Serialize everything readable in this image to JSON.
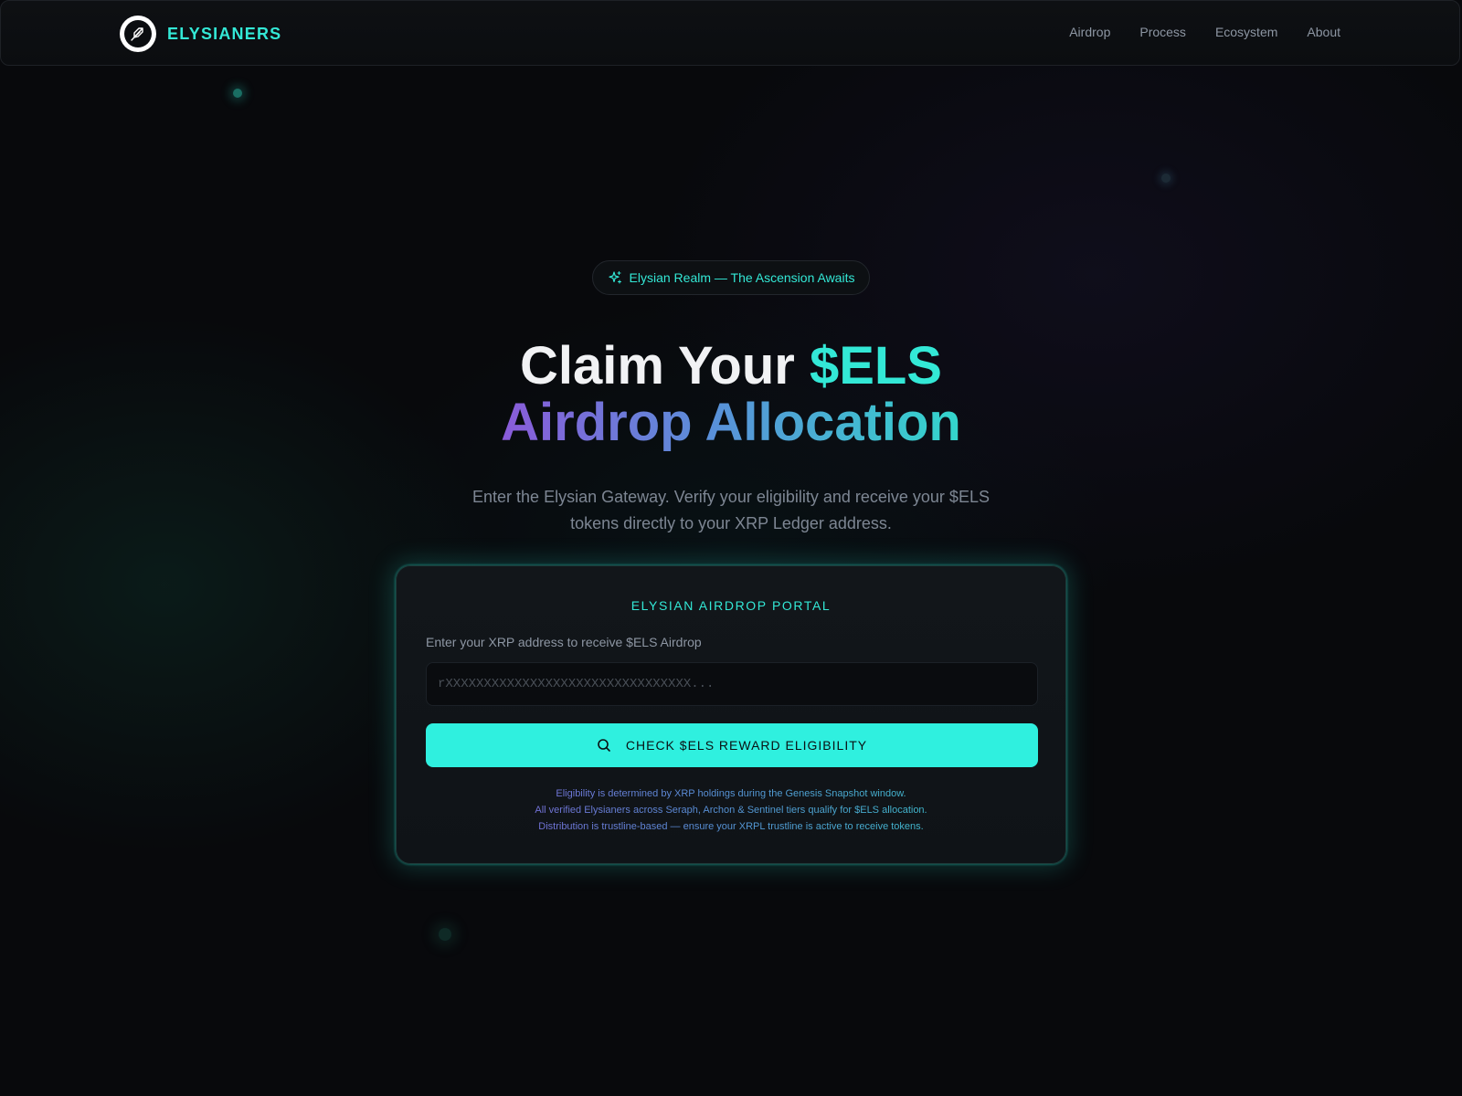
{
  "brand": {
    "name": "ELYSIANERS",
    "logo_icon": "feather-quill-icon"
  },
  "nav": {
    "links": [
      "Airdrop",
      "Process",
      "Ecosystem",
      "About"
    ]
  },
  "hero": {
    "badge_icon": "sparkles-icon",
    "badge_text": "Elysian Realm — The Ascension Awaits",
    "title_part1": "Claim Your ",
    "title_accent": "$ELS",
    "title_line2": "Airdrop Allocation",
    "subtitle": "Enter the Elysian Gateway. Verify your eligibility and receive your $ELS tokens directly to your XRP Ledger address."
  },
  "portal": {
    "title": "ELYSIAN AIRDROP PORTAL",
    "field_label": "Enter your XRP address to receive $ELS Airdrop",
    "input_value": "",
    "input_placeholder": "rXXXXXXXXXXXXXXXXXXXXXXXXXXXXXXXX...",
    "button_icon": "search-icon",
    "button_label": "CHECK $ELS REWARD ELIGIBILITY",
    "notes": [
      "Eligibility is determined by XRP holdings during the Genesis Snapshot window.",
      "All verified Elysianers across Seraph, Archon & Sentinel tiers qualify for $ELS allocation.",
      "Distribution is trustline-based — ensure your XRPL trustline is active to receive tokens."
    ]
  },
  "colors": {
    "accent": "#33e8d6",
    "button": "#2ff0df",
    "background": "#08090c",
    "gradient_start": "#8a5bd9",
    "gradient_end": "#33d6cc",
    "muted_text": "#7d8693"
  }
}
